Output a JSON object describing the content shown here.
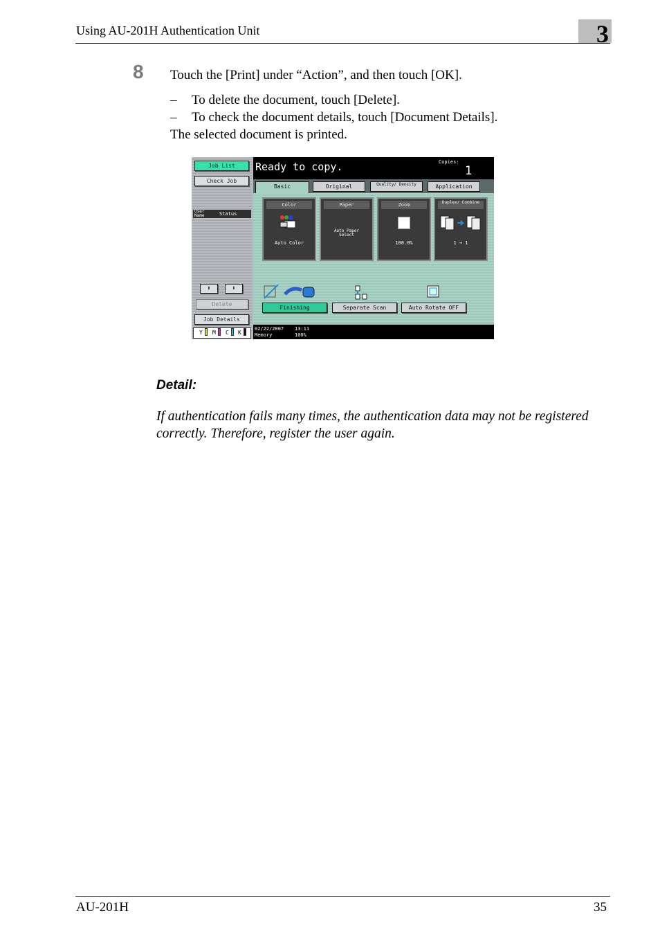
{
  "header": {
    "title": "Using AU-201H Authentication Unit",
    "chapter": "3"
  },
  "step": {
    "number": "8",
    "text": "Touch the [Print] under “Action”, and then touch [OK].",
    "subitems": [
      {
        "dash": "–",
        "text": "To delete the document, touch [Delete]."
      },
      {
        "dash": "–",
        "text": "To check the document details, touch [Document Details]."
      }
    ],
    "result": "The selected document is printed."
  },
  "panel": {
    "left": {
      "job_list": "Job List",
      "check_job": "Check Job",
      "col_user": "User Name",
      "col_status": "Status",
      "up": "⬆",
      "down": "⬇",
      "delete": "Delete",
      "job_details": "Job Details",
      "toner": [
        "Y",
        "M",
        "C",
        "K"
      ],
      "toner_colors": [
        "#e6d81a",
        "#d6289c",
        "#22b9d6",
        "#111111"
      ]
    },
    "ready_text": "Ready to copy.",
    "copies_label": "Copies:",
    "copies_value": "1",
    "tabs": [
      "Basic",
      "Original Setting",
      "Quality/ Density",
      "Application"
    ],
    "cards": [
      {
        "title": "Color",
        "value": "Auto Color"
      },
      {
        "title": "Paper",
        "value": "Auto Paper Select"
      },
      {
        "title": "Zoom",
        "value": "100.0%"
      },
      {
        "title": "Duplex/ Combine",
        "value": "1 ➔ 1"
      }
    ],
    "buttons": [
      "Finishing",
      "Separate Scan",
      "Auto Rotate OFF"
    ],
    "status_date": "02/22/2007",
    "status_time": "13:11",
    "status_memory": "Memory",
    "status_memory_val": "100%",
    "accent_color": "#35e3a8"
  },
  "detail": {
    "heading": "Detail:",
    "body": "If authentication fails many times, the authentication data may not be registered correctly. Therefore, register the user again."
  },
  "footer": {
    "left": "AU-201H",
    "page": "35"
  }
}
